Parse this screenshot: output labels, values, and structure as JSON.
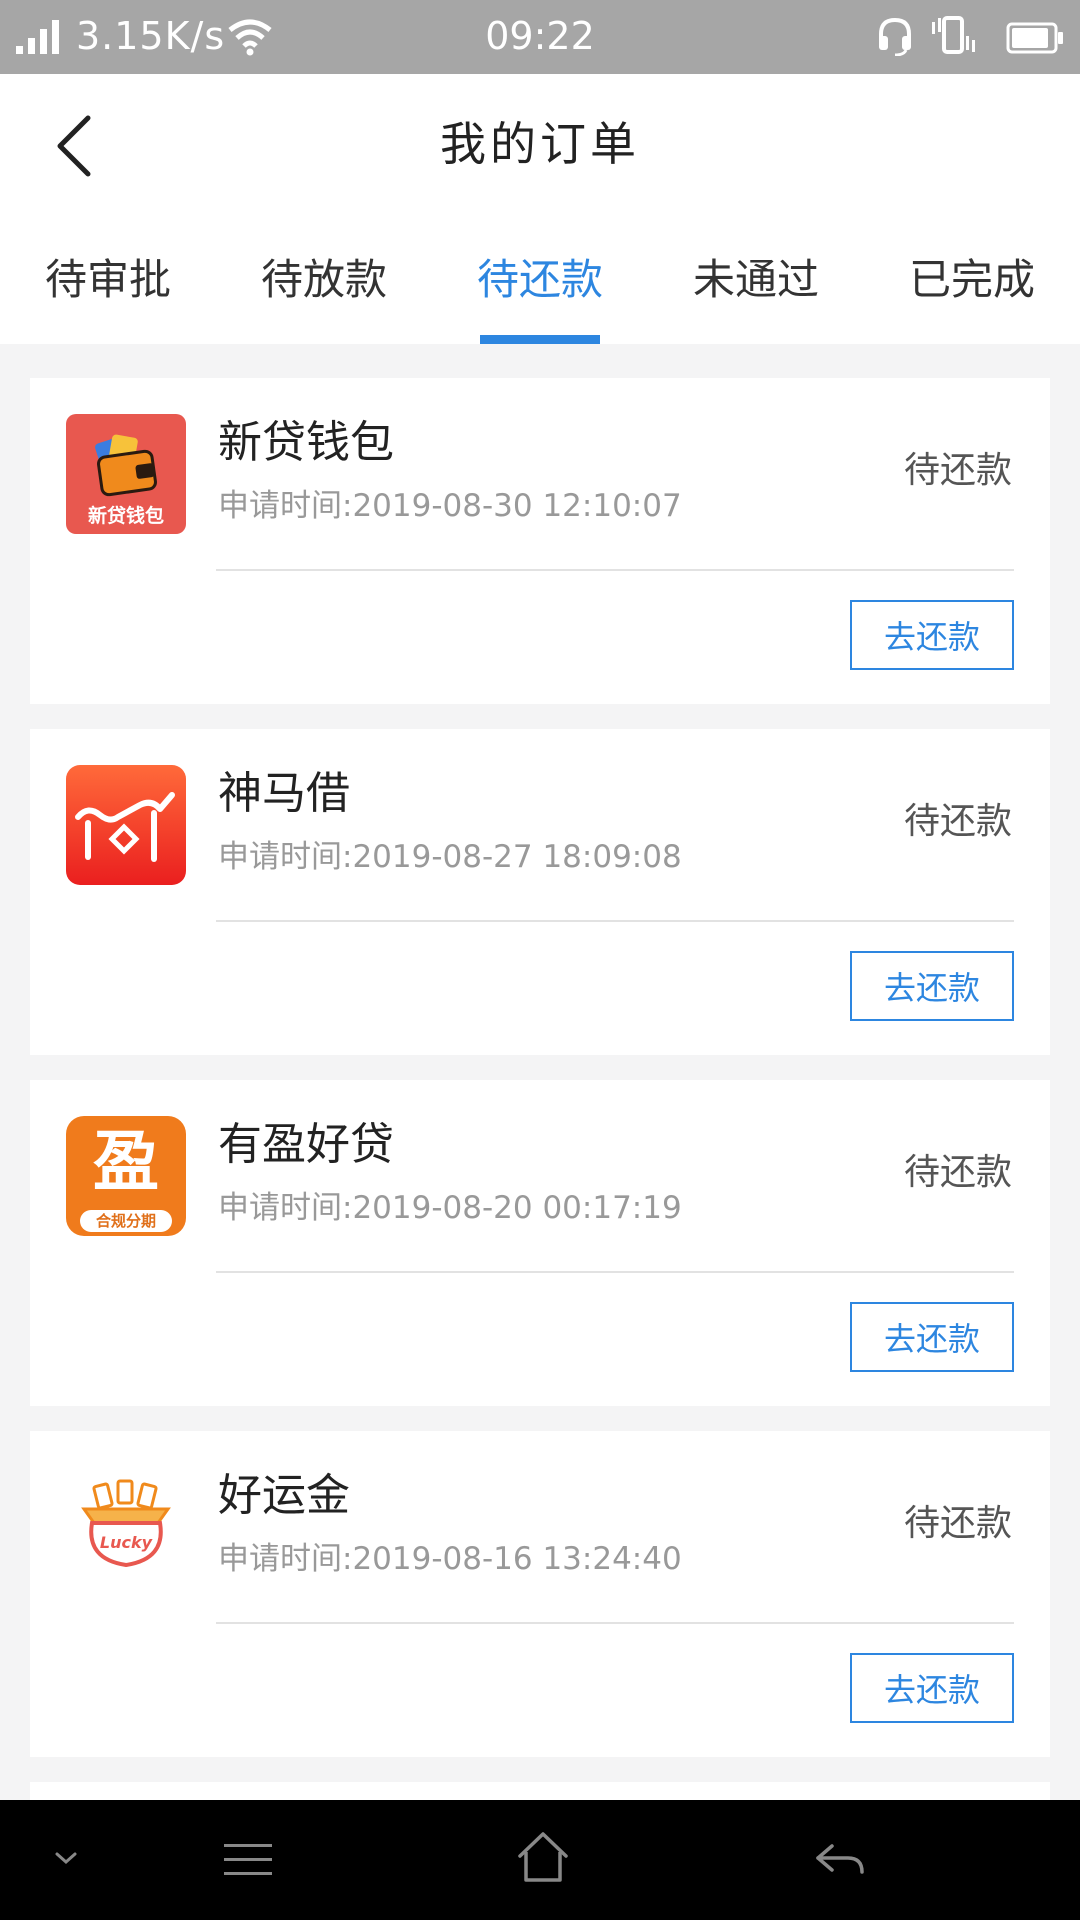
{
  "status_bar": {
    "net_speed": "3.15K/s",
    "time": "09:22",
    "icons": [
      "signal-icon",
      "wifi-icon",
      "headset-icon",
      "vibrate-icon",
      "battery-icon"
    ]
  },
  "header": {
    "title": "我的订单",
    "back_icon": "chevron-left-icon"
  },
  "tabs": [
    {
      "label": "待审批",
      "active": false
    },
    {
      "label": "待放款",
      "active": false
    },
    {
      "label": "待还款",
      "active": true
    },
    {
      "label": "未通过",
      "active": false
    },
    {
      "label": "已完成",
      "active": false
    }
  ],
  "orders": [
    {
      "name": "新贷钱包",
      "logo_text": "新贷钱包",
      "time": "申请时间:2019-08-30 12:10:07",
      "status": "待还款",
      "action": "去还款"
    },
    {
      "name": "神马借",
      "time": "申请时间:2019-08-27 18:09:08",
      "status": "待还款",
      "action": "去还款"
    },
    {
      "name": "有盈好贷",
      "logo_text": "盈",
      "logo_subtext": "合规分期",
      "time": "申请时间:2019-08-20 00:17:19",
      "status": "待还款",
      "action": "去还款"
    },
    {
      "name": "好运金",
      "logo_text": "Lucky",
      "time": "申请时间:2019-08-16 13:24:40",
      "status": "待还款",
      "action": "去还款"
    }
  ],
  "colors": {
    "accent": "#2d86e0",
    "status_bar": "#a6a6a6",
    "background": "#f4f4f5"
  },
  "system_nav": [
    "collapse-icon",
    "menu-icon",
    "home-icon",
    "back-icon"
  ]
}
